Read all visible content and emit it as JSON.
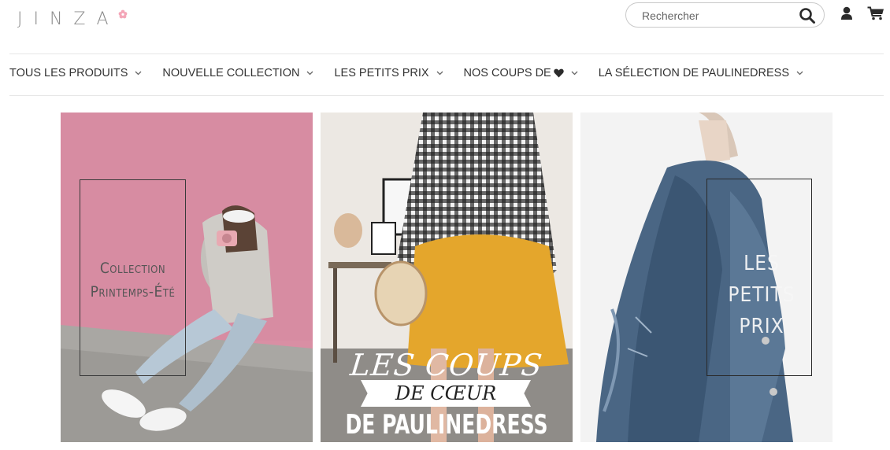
{
  "brand": {
    "logo_text": "JINZA"
  },
  "search": {
    "placeholder": "Rechercher"
  },
  "nav": {
    "items": [
      {
        "label": "TOUS LES PRODUITS"
      },
      {
        "label": "NOUVELLE COLLECTION"
      },
      {
        "label": "LES PETITS PRIX"
      },
      {
        "label": "NOS COUPS DE"
      },
      {
        "label": "LA SÉLECTION DE PAULINEDRESS"
      }
    ]
  },
  "banners": [
    {
      "caption_line1": "Collection",
      "caption_line2": "Printemps-Été"
    },
    {
      "line1": "LES COUPS",
      "line2": "DE CŒUR",
      "line3": "DE PAULINEDRESS"
    },
    {
      "caption_line1": "LES PETITS",
      "caption_line2": "PRIX"
    }
  ],
  "colors": {
    "accent_pink": "#f4a6b8",
    "banner1_bg": "#d98fa4",
    "banner2_skirt": "#e4a62c",
    "banner3_denim": "#4a6684"
  }
}
